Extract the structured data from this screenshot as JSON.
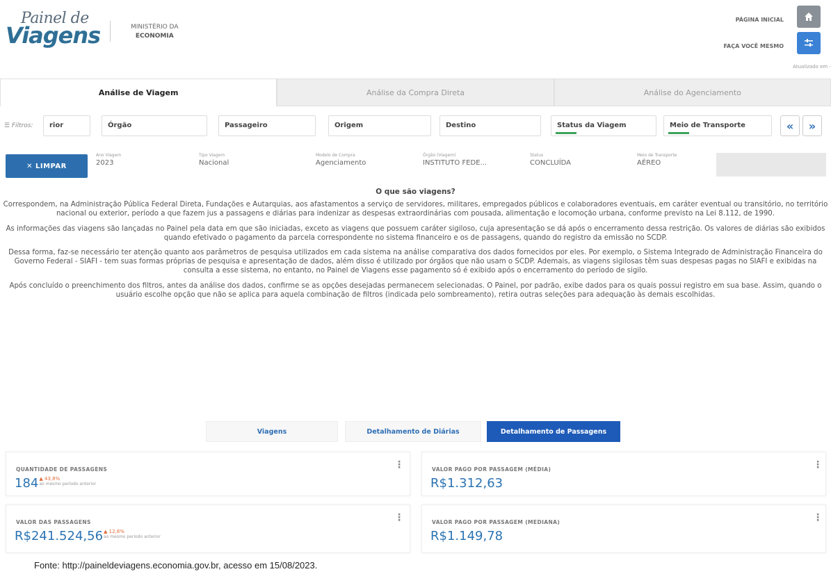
{
  "header": {
    "logo_line1": "Painel de",
    "logo_line2": "Viagens",
    "ministry_line1": "MINISTÉRIO DA",
    "ministry_line2": "ECONOMIA",
    "nav_home": "PÁGINA INICIAL",
    "nav_diy": "FAÇA VOCÊ MESMO",
    "updated": "Atualizado em -",
    "home_icon": "home-icon",
    "diy_icon": "sliders-icon"
  },
  "tabs": [
    {
      "label": "Análise de Viagem",
      "active": true
    },
    {
      "label": "Análise da Compra Direta",
      "active": false
    },
    {
      "label": "Análise do Agenciamento",
      "active": false
    }
  ],
  "filters": {
    "label": "Filtros:",
    "items": [
      "rior",
      "Órgão",
      "Passageiro",
      "Origem",
      "Destino",
      "Status da Viagem",
      "Meio de Transporte"
    ],
    "prev": "«",
    "next": "»"
  },
  "selected": {
    "clear_label": "✕  LIMPAR",
    "items": [
      {
        "key": "Ano Viagem",
        "value": "2023"
      },
      {
        "key": "Tipo Viagem",
        "value": "Nacional"
      },
      {
        "key": "Modelo de Compra",
        "value": "Agenciamento"
      },
      {
        "key": "Órgão (Viagem)",
        "value": "INSTITUTO FEDE..."
      },
      {
        "key": "Status",
        "value": "CONCLUÍDA"
      },
      {
        "key": "Meio de Transporte",
        "value": "AÉREO"
      }
    ]
  },
  "content": {
    "heading": "O que são viagens?",
    "paragraphs": [
      "Correspondem, na Administração Pública Federal Direta, Fundações e Autarquias, aos afastamentos a serviço de servidores, militares, empregados públicos e colaboradores eventuais, em caráter eventual ou transitório, no território nacional ou exterior, período a que fazem jus a passagens e diárias para indenizar as despesas extraordinárias com pousada, alimentação e locomoção urbana, conforme previsto na Lei 8.112, de 1990.",
      "As informações das viagens são lançadas no Painel pela data em que são iniciadas, exceto as viagens que possuem caráter sigiloso, cuja apresentação se dá após o encerramento dessa restrição. Os valores de diárias são exibidos quando efetivado o pagamento da parcela correspondente no sistema financeiro e os de passagens, quando do registro da emissão no SCDP.",
      "Dessa forma, faz-se necessário ter atenção quanto aos parâmetros de pesquisa utilizados em cada sistema na análise comparativa dos dados fornecidos por eles. Por exemplo, o Sistema Integrado de Administração Financeira do Governo Federal - SIAFI - tem suas formas próprias de pesquisa e apresentação de dados, além disso é utilizado por órgãos que não usam o SCDP. Ademais, as viagens sigilosas têm suas despesas pagas no SIAFI e exibidas na consulta a esse sistema, no entanto, no Painel de Viagens esse pagamento só é exibido após o encerramento do período de sigilo.",
      "Após concluído o preenchimento dos filtros, antes da análise dos dados, confirme se as opções desejadas permanecem selecionadas. O Painel, por padrão, exibe dados para os quais possui registro em sua base. Assim, quando o usuário escolhe opção que não se aplica para aquela combinação de filtros (indicada pelo sombreamento), retira outras seleções para adequação às demais escolhidas."
    ]
  },
  "section_tabs": [
    {
      "label": "Viagens",
      "active": false
    },
    {
      "label": "Detalhamento de Diárias",
      "active": false
    },
    {
      "label": "Detalhamento de Passagens",
      "active": true
    }
  ],
  "kpis": [
    {
      "title": "QUANTIDADE DE PASSAGENS",
      "value": "184",
      "delta": "▲ 43,8%",
      "delta_sub": "ao mesmo período anterior"
    },
    {
      "title": "VALOR PAGO POR PASSAGEM (MÉDIA)",
      "value": "R$1.312,63",
      "delta": "",
      "delta_sub": ""
    },
    {
      "title": "VALOR DAS PASSAGENS",
      "value": "R$241.524,56",
      "delta": "▲ 12,8%",
      "delta_sub": "ao mesmo período anterior"
    },
    {
      "title": "VALOR PAGO POR PASSAGEM (MEDIANA)",
      "value": "R$1.149,78",
      "delta": "",
      "delta_sub": ""
    }
  ],
  "kpi_menu": "⋮",
  "source": "Fonte: http://paineldeviagens.economia.gov.br, acesso em 15/08/2023.",
  "colors": {
    "primary": "#2d6fae",
    "accent": "#1e5bb8",
    "value": "#2b73b3",
    "positive": "#e06b3a"
  }
}
